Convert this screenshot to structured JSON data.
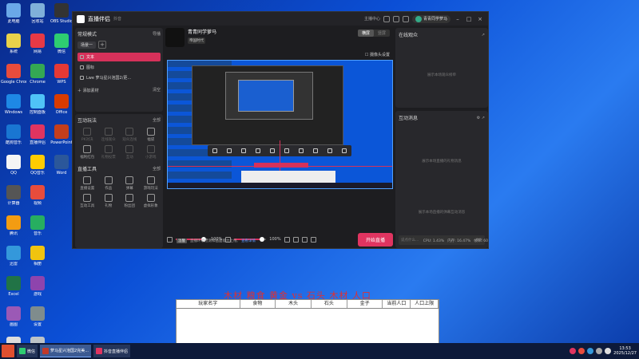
{
  "desktop_icons": [
    {
      "label": "此电脑",
      "color": "#6aa8e8"
    },
    {
      "label": "系统",
      "color": "#e8d24a"
    },
    {
      "label": "Google Chrome",
      "color": "#e74c3c"
    },
    {
      "label": "Windows",
      "color": "#1e88e5"
    },
    {
      "label": "酷狗音乐",
      "color": "#1976d2"
    },
    {
      "label": "QQ",
      "color": "#f5f5f5"
    },
    {
      "label": "回收站",
      "color": "#7fb0d9"
    },
    {
      "label": "网易",
      "color": "#e63946"
    },
    {
      "label": "Chrome",
      "color": "#34a853"
    },
    {
      "label": "控制面板",
      "color": "#4fc3f7"
    },
    {
      "label": "直播伴侣",
      "color": "#e03460"
    },
    {
      "label": "QQ音乐",
      "color": "#ffcc00"
    },
    {
      "label": "OBS Studio",
      "color": "#333"
    },
    {
      "label": "微信",
      "color": "#2ecc71"
    },
    {
      "label": "WPS",
      "color": "#e53935"
    },
    {
      "label": "Office",
      "color": "#d83b01"
    },
    {
      "label": "PowerPoint",
      "color": "#c43e1c"
    },
    {
      "label": "Word",
      "color": "#2b579a"
    },
    {
      "label": "计算器",
      "color": "#555"
    },
    {
      "label": "腾讯",
      "color": "#f39c12"
    },
    {
      "label": "迅雷",
      "color": "#3498db"
    },
    {
      "label": "Excel",
      "color": "#217346"
    },
    {
      "label": "画图",
      "color": "#9b59b6"
    },
    {
      "label": "记事本",
      "color": "#ddd"
    },
    {
      "label": "视频",
      "color": "#e74c3c"
    },
    {
      "label": "音乐",
      "color": "#27ae60"
    },
    {
      "label": "相册",
      "color": "#f1c40f"
    },
    {
      "label": "游戏",
      "color": "#8e44ad"
    },
    {
      "label": "设置",
      "color": "#7f8c8d"
    },
    {
      "label": "新建文件",
      "color": "#bdc3c7"
    }
  ],
  "app": {
    "title": "直播伴侣",
    "version": "抖音",
    "header_items": [
      "主播中心"
    ],
    "username": "青青同学萝马",
    "scene_mode": "常规模式",
    "import_label": "导播",
    "scene_tab": "场景一",
    "sources": [
      {
        "label": "文本",
        "selected": true
      },
      {
        "label": "图标",
        "selected": false
      },
      {
        "label": "Lwe 萝马星兴泡国2/更...",
        "selected": false
      }
    ],
    "add_source": "添加素材",
    "clear_label": "清空",
    "interact_title": "互动玩法",
    "all_label": "全部",
    "interact_items": [
      {
        "label": "PK对决",
        "dim": true
      },
      {
        "label": "连线观众",
        "dim": true
      },
      {
        "label": "观众连线",
        "dim": true
      },
      {
        "label": "福袋",
        "dim": false
      },
      {
        "label": "福利红包",
        "dim": false
      },
      {
        "label": "礼物投票",
        "dim": true
      },
      {
        "label": "互动",
        "dim": true
      },
      {
        "label": "小游戏",
        "dim": true
      }
    ],
    "tools_title": "直播工具",
    "tools_all": "全部",
    "tool_items": [
      {
        "label": "直播设置"
      },
      {
        "label": "作品"
      },
      {
        "label": "弹幕"
      },
      {
        "label": "游戏玩法"
      },
      {
        "label": "互动工具"
      },
      {
        "label": "礼物"
      },
      {
        "label": "粉丝团"
      },
      {
        "label": "虚拟形象"
      }
    ],
    "account_name": "青青同学萝马",
    "account_tag": "帝国时代",
    "mode_landscape": "横屏",
    "mode_portrait": "竖屏",
    "camera_setting": "摄像头设置",
    "mic_pct": "100%",
    "speaker_pct": "100%",
    "start_button": "开始直播",
    "online_title": "在线观众",
    "online_empty": "展示本场观众榜单",
    "msg_title": "互动消息",
    "msg_empty1": "展示本场直播的礼物消息",
    "msg_empty2": "展示本场直播的弹幕互动消息",
    "msg_input": "说点什么...",
    "send_label": "发送",
    "status_badge": "温馨",
    "status_text": "直播环境检测和画面能力上线,",
    "status_link": "查看详情",
    "cpu": "CPU: 1.43%",
    "mem": "内存: 16.47%",
    "fps": "帧率: 60"
  },
  "overlay_text": "木材 粮食 黄金 vs 石头 木材 人口",
  "table_headers": [
    "玩家名字",
    "食物",
    "木头",
    "石头",
    "金子",
    "当前人口",
    "人口上限"
  ],
  "taskbar": {
    "items": [
      {
        "label": "微信",
        "color": "#2ecc71",
        "active": false
      },
      {
        "label": "萝马星兴泡国2完美...",
        "color": "#c0392b",
        "active": true
      },
      {
        "label": "抖音直播伴侣",
        "color": "#e03460",
        "active": false
      }
    ],
    "time": "13:53",
    "date": "2025/12/27"
  }
}
